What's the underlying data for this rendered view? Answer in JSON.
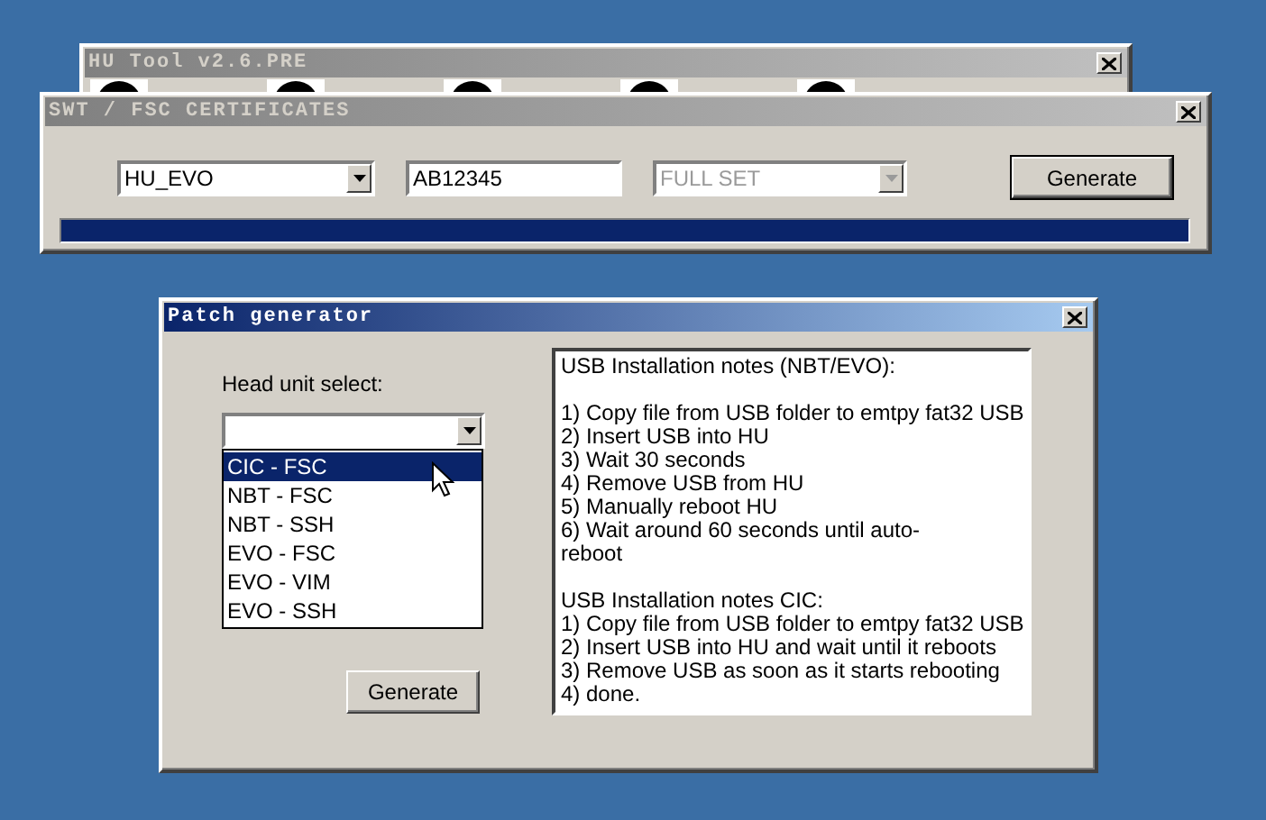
{
  "hu_tool": {
    "title": "HU Tool v2.6.PRE",
    "active": false
  },
  "certificates": {
    "title": "SWT / FSC CERTIFICATES",
    "active": false,
    "unit_select": {
      "value": "HU_EVO",
      "disabled": false
    },
    "serial_field": {
      "value": "AB12345"
    },
    "set_select": {
      "value": "FULL SET",
      "disabled": true
    },
    "generate_button": "Generate",
    "progress": {
      "level": 1
    }
  },
  "patch_generator": {
    "title": "Patch generator",
    "active": true,
    "head_unit_label": "Head unit select:",
    "head_unit_select": {
      "expanded": true
    },
    "options": [
      {
        "label": "CIC - FSC",
        "selected": true
      },
      {
        "label": "NBT - FSC",
        "selected": false
      },
      {
        "label": "NBT - SSH",
        "selected": false
      },
      {
        "label": "EVO - FSC",
        "selected": false
      },
      {
        "label": "EVO - VIM",
        "selected": false
      },
      {
        "label": "EVO - SSH",
        "selected": false
      }
    ],
    "generate_button": "Generate",
    "notes": [
      [
        "USB Installation notes (NBT/EVO):"
      ],
      [
        "1) Copy file from USB folder to emtpy fat32 USB",
        "2) Insert USB into HU",
        "3) Wait 30 seconds",
        "4) Remove USB from HU",
        "5) Manually reboot HU",
        "6) Wait around 60 seconds until auto-",
        "reboot"
      ],
      [
        "USB Installation notes CIC:",
        "1) Copy file from USB folder to emtpy fat32 USB",
        "2) Insert USB into HU and wait until it reboots",
        "3) Remove USB as soon as it starts rebooting",
        "4) done."
      ]
    ]
  }
}
